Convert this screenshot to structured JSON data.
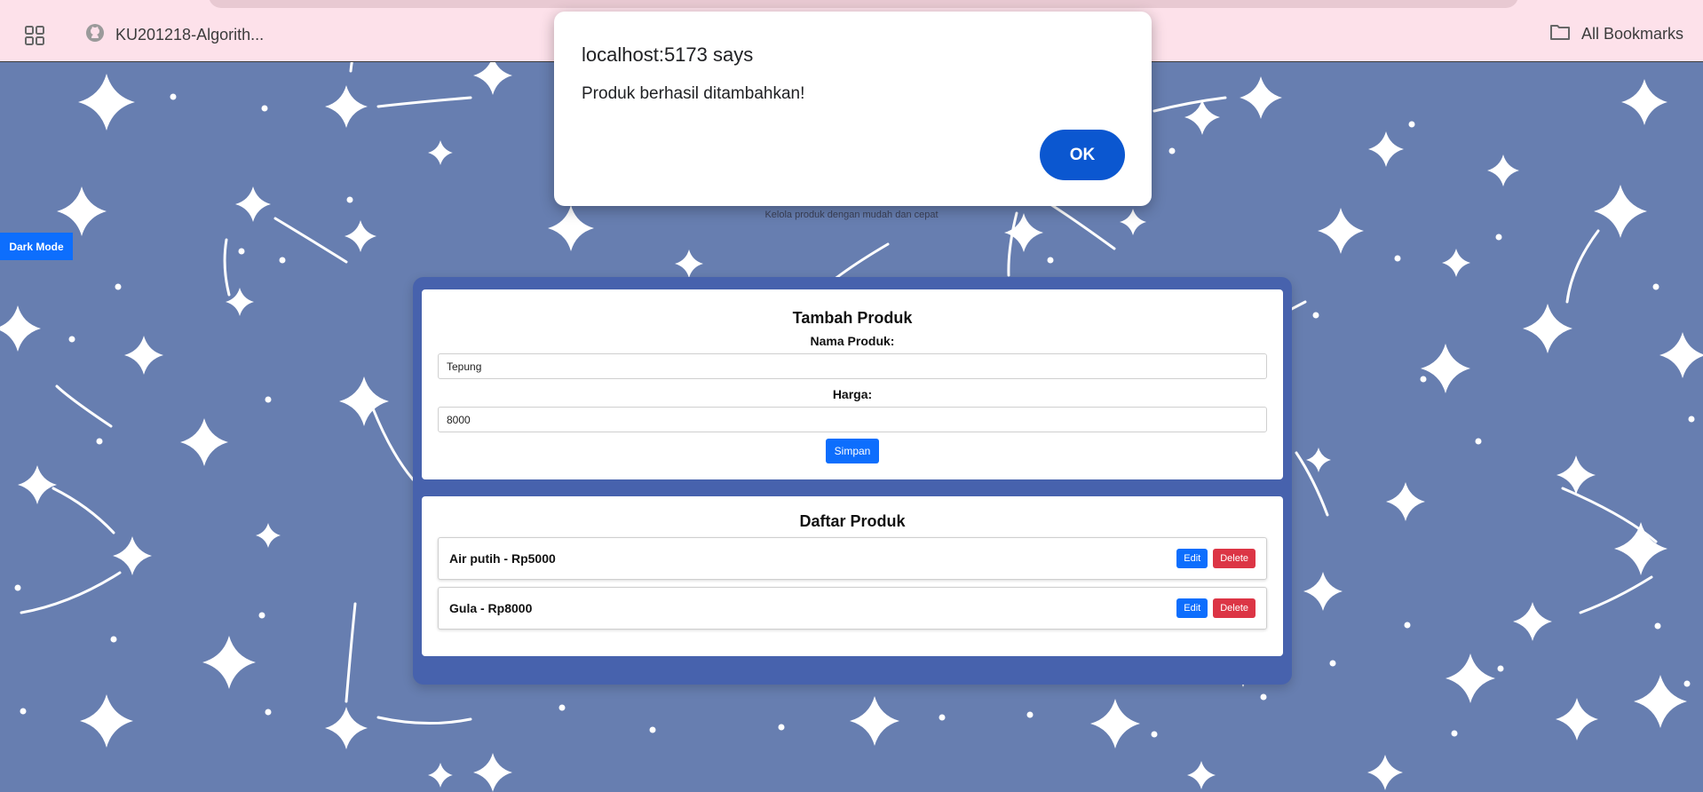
{
  "browser": {
    "bookmark_tab": "KU201218-Algorith...",
    "all_bookmarks": "All Bookmarks"
  },
  "page": {
    "subtitle": "Kelola produk dengan mudah dan cepat",
    "dark_mode_label": "Dark Mode"
  },
  "form": {
    "title": "Tambah Produk",
    "name_label": "Nama Produk:",
    "name_value": "Tepung",
    "price_label": "Harga:",
    "price_value": "8000",
    "save_label": "Simpan"
  },
  "list": {
    "title": "Daftar Produk",
    "items": [
      {
        "text": "Air putih - Rp5000",
        "edit": "Edit",
        "delete": "Delete"
      },
      {
        "text": "Gula - Rp8000",
        "edit": "Edit",
        "delete": "Delete"
      }
    ]
  },
  "dialog": {
    "title": "localhost:5173 says",
    "message": "Produk berhasil ditambahkan!",
    "ok_label": "OK"
  },
  "colors": {
    "primary": "#0d6efd",
    "danger": "#dc3545",
    "background": "#677eb0",
    "container": "#4762ad",
    "bookmarks_bar": "#fde1ea"
  }
}
